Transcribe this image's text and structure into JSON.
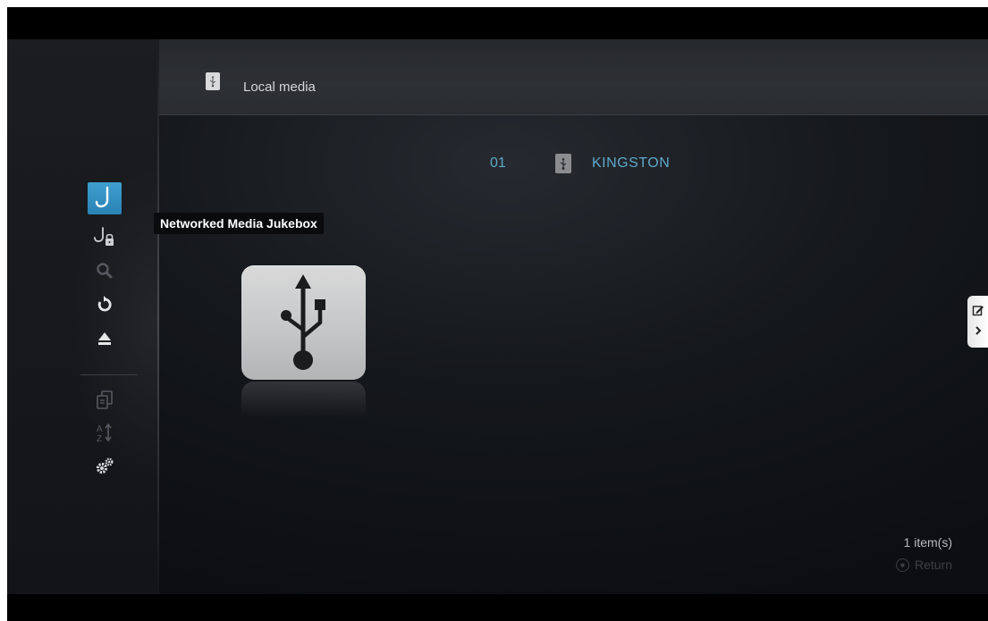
{
  "header": {
    "title": "Local media",
    "icon": "usb-icon"
  },
  "sidebar": {
    "tooltip": "Networked Media Jukebox",
    "items": [
      {
        "name": "jukebox",
        "icon": "jukebox-icon",
        "active": true
      },
      {
        "name": "jukebox-lock",
        "icon": "jukebox-lock-icon"
      },
      {
        "name": "search",
        "icon": "search-icon"
      },
      {
        "name": "refresh",
        "icon": "refresh-icon"
      },
      {
        "name": "eject",
        "icon": "eject-icon"
      },
      {
        "name": "copy",
        "icon": "copy-icon"
      },
      {
        "name": "sort",
        "icon": "sort-az-icon"
      },
      {
        "name": "settings",
        "icon": "settings-icon"
      }
    ]
  },
  "list": {
    "rows": [
      {
        "number": "01",
        "label": "KINGSTON",
        "icon": "usb-icon"
      }
    ]
  },
  "footer": {
    "count": "1 item(s)",
    "return_label": "Return"
  },
  "colors": {
    "accent": "#2a82b5",
    "list_text": "#5ea8c9",
    "background": "#15181c"
  }
}
